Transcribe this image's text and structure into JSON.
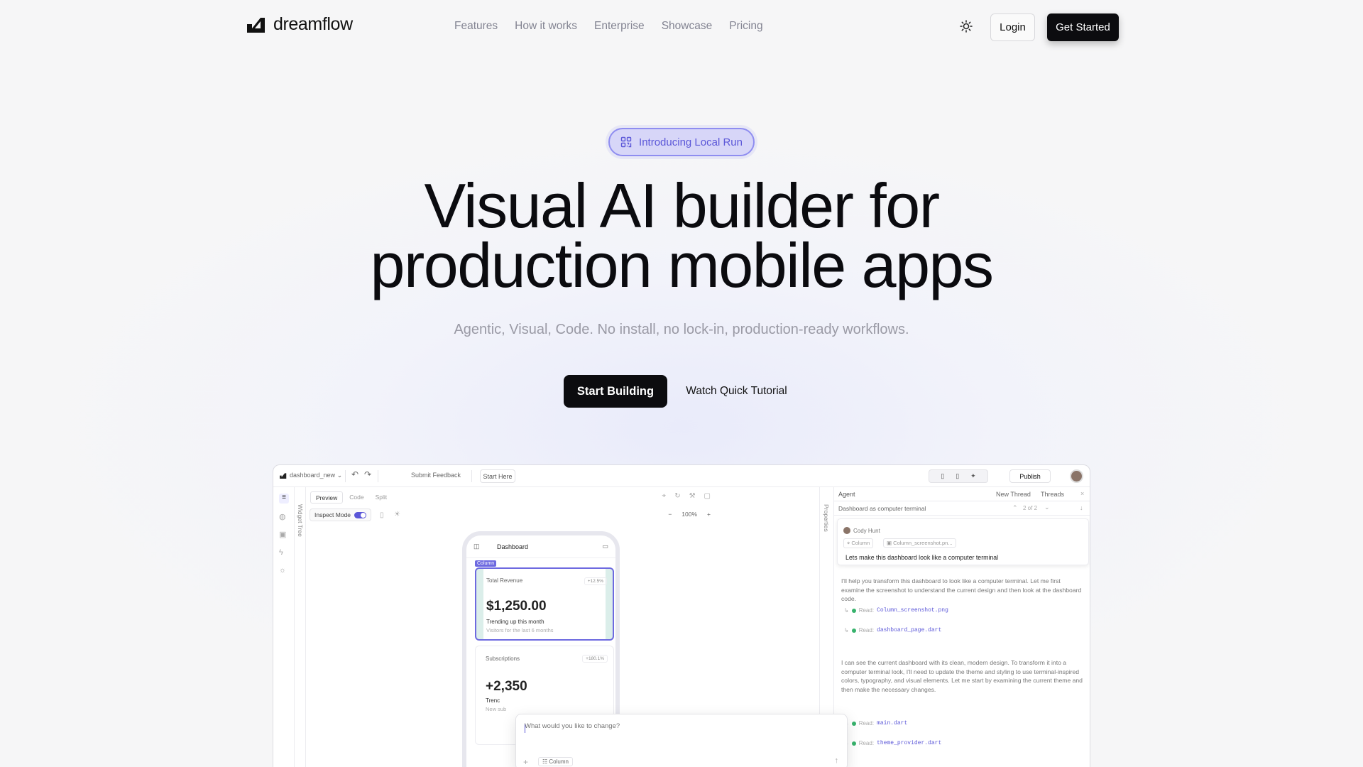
{
  "nav": {
    "brand": "dreamflow",
    "links": [
      "Features",
      "How it works",
      "Enterprise",
      "Showcase",
      "Pricing"
    ],
    "login": "Login",
    "get_started": "Get Started"
  },
  "hero": {
    "badge": "Introducing Local Run",
    "title_line1": "Visual AI builder for",
    "title_line2": "production mobile apps",
    "subtitle": "Agentic, Visual, Code. No install, no lock-in, production-ready workflows.",
    "cta_primary": "Start Building",
    "cta_secondary": "Watch Quick Tutorial"
  },
  "app": {
    "project": "dashboard_new",
    "submit_feedback": "Submit Feedback",
    "start_here": "Start Here",
    "publish": "Publish",
    "tabs": [
      "Preview",
      "Code",
      "Split"
    ],
    "inspect": "Inspect Mode",
    "zoom": "100%",
    "widget_tree": "Widget Tree",
    "properties": "Properties",
    "phone": {
      "title": "Dashboard",
      "selected": "Column",
      "card1": {
        "label": "Total Revenue",
        "chip": "+12.5%",
        "value": "$1,250.00",
        "trend": "Trending up this month",
        "note": "Visitors for the last 6 months"
      },
      "card2": {
        "label": "Subscriptions",
        "chip": "+180.1%",
        "value": "+2,350",
        "trend": "Trenc",
        "note": "New sub"
      }
    },
    "prompt": {
      "placeholder": "What would you like to change?",
      "chip": "Column"
    },
    "agent": {
      "title": "Agent",
      "new_thread": "New Thread",
      "threads": "Threads",
      "thread_title": "Dashboard as computer terminal",
      "pager": "2 of 2",
      "user": "Cody Hunt",
      "attach1": "Column",
      "attach2": "Column_screenshot.pn...",
      "message": "Lets make this dashboard look like a computer terminal",
      "reply1": "I'll help you transform this dashboard to look like a computer terminal. Let me first examine the screenshot to understand the current design and then look at the dashboard code.",
      "read_label": "Read:",
      "file1": "Column_screenshot.png",
      "file2": "dashboard_page.dart",
      "reply2": "I can see the current dashboard with its clean, modern design. To transform it into a computer terminal look, I'll need to update the theme and styling to use terminal-inspired colors, typography, and visual elements. Let me start by examining the current theme and then make the necessary changes.",
      "file3": "main.dart",
      "file4": "theme_provider.dart"
    }
  }
}
